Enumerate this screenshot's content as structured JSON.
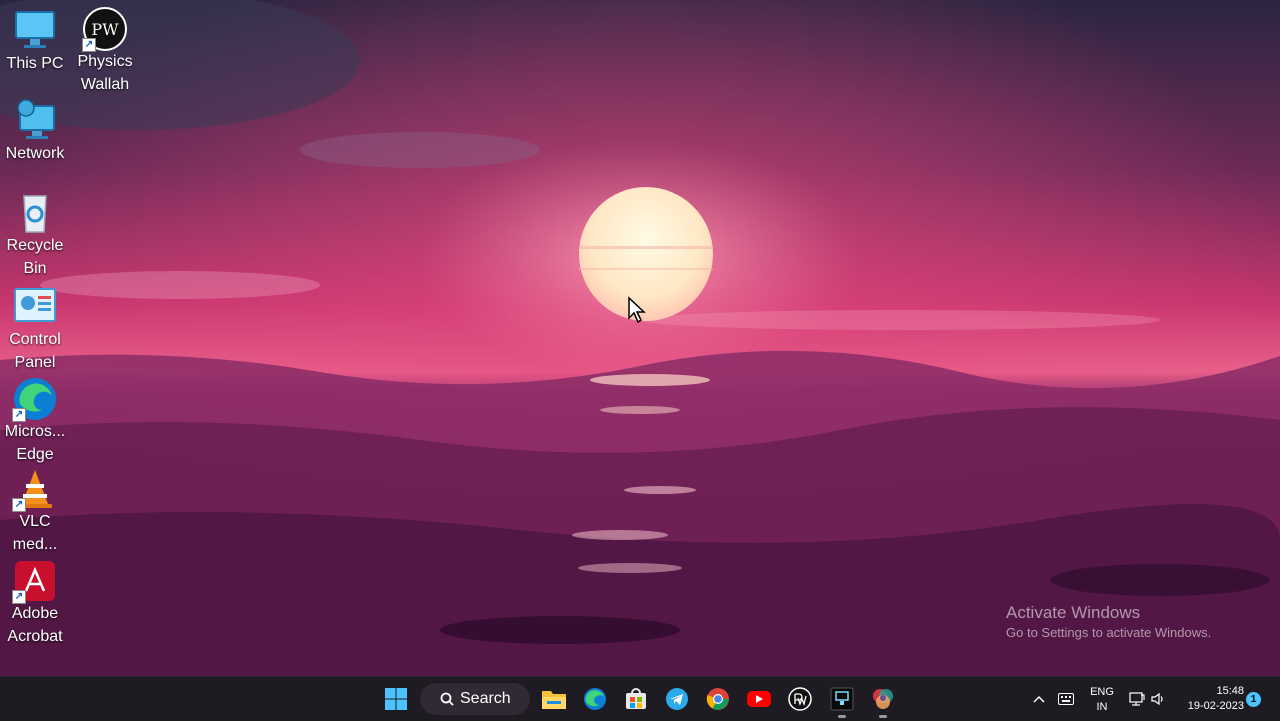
{
  "desktop": {
    "icons": [
      {
        "label": "This PC",
        "icon": "this-pc-icon"
      },
      {
        "label": "Physics Wallah",
        "icon": "physics-wallah-icon",
        "logo_text": "PW"
      },
      {
        "label": "Network",
        "icon": "network-icon"
      },
      {
        "label": "Recycle Bin",
        "icon": "recycle-bin-icon"
      },
      {
        "label": "Control Panel",
        "icon": "control-panel-icon"
      },
      {
        "label": "Micros... Edge",
        "icon": "edge-icon"
      },
      {
        "label": "VLC med...",
        "icon": "vlc-icon"
      },
      {
        "label": "Adobe Acrobat",
        "icon": "acrobat-icon"
      }
    ],
    "watermark": {
      "title": "Activate Windows",
      "subtitle": "Go to Settings to activate Windows."
    }
  },
  "taskbar": {
    "search_label": "Search",
    "pinned_apps": [
      "start-icon",
      "file-explorer-icon",
      "edge-icon",
      "store-icon",
      "telegram-icon",
      "chrome-icon",
      "youtube-icon",
      "physics-wallah-icon",
      "terminal-app-icon",
      "color-app-icon"
    ],
    "tray": {
      "lang_line1": "ENG",
      "lang_line2": "IN",
      "time": "15:48",
      "date": "19-02-2023",
      "notification_count": "1"
    }
  },
  "colors": {
    "taskbar_bg": "#1f1b22",
    "sky_top": "#2b2540",
    "sky_glow": "#e0457e",
    "sea": "#5a1a45",
    "accent": "#4cc2ff"
  }
}
